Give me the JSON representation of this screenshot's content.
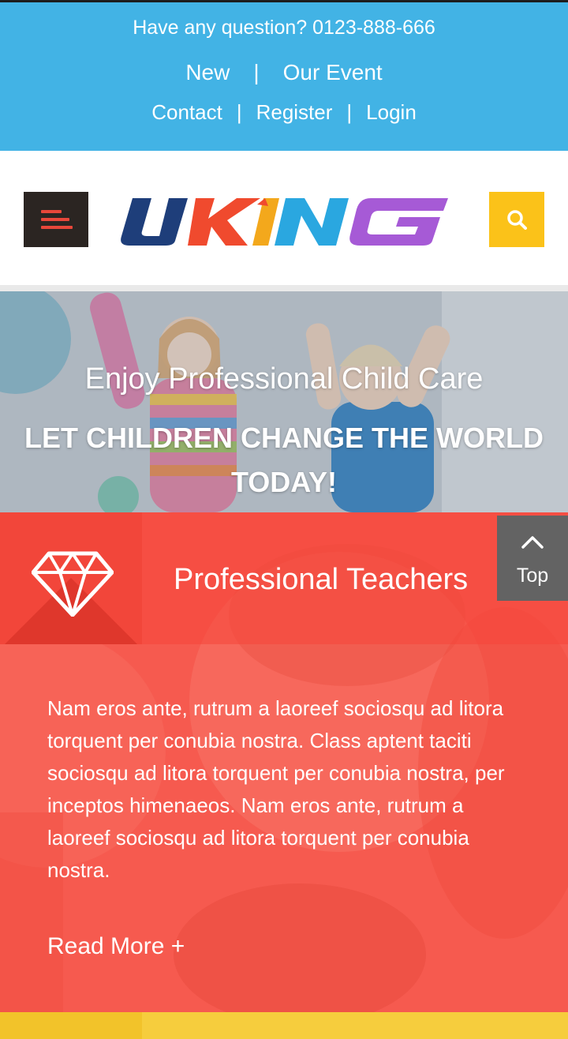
{
  "topbar": {
    "question": "Have any question? 0123-888-666",
    "nav_row1": [
      "New",
      "Our Event"
    ],
    "nav_row2": [
      "Contact",
      "Register",
      "Login"
    ],
    "separator": "|",
    "bg_color": "#42b3e5"
  },
  "header": {
    "menu_icon": "hamburger-icon",
    "logo_text": "UKING",
    "search_icon": "search-icon"
  },
  "hero": {
    "subtitle": "Enjoy Professional Child Care",
    "title": "LET CHILDREN CHANGE THE WORLD TODAY!"
  },
  "feature": {
    "icon": "diamond-icon",
    "title": "Professional Teachers",
    "text": "Nam eros ante, rutrum a laoreef sociosqu ad litora torquent per conubia nostra. Class aptent taciti sociosqu ad litora torquent per conubia nostra, per inceptos himenaeos. Nam eros ante, rutrum a laoreef sociosqu ad litora torquent per conubia nostra.",
    "read_more": "Read More +",
    "bg_color": "#f6584d"
  },
  "top_button": {
    "label": "Top",
    "icon": "chevron-up-icon"
  },
  "colors": {
    "menu_bg": "#2b2522",
    "menu_lines": "#e8473a",
    "search_bg": "#fbc219",
    "top_btn_bg": "#636363",
    "yellow_strip": "#f2c32a"
  }
}
